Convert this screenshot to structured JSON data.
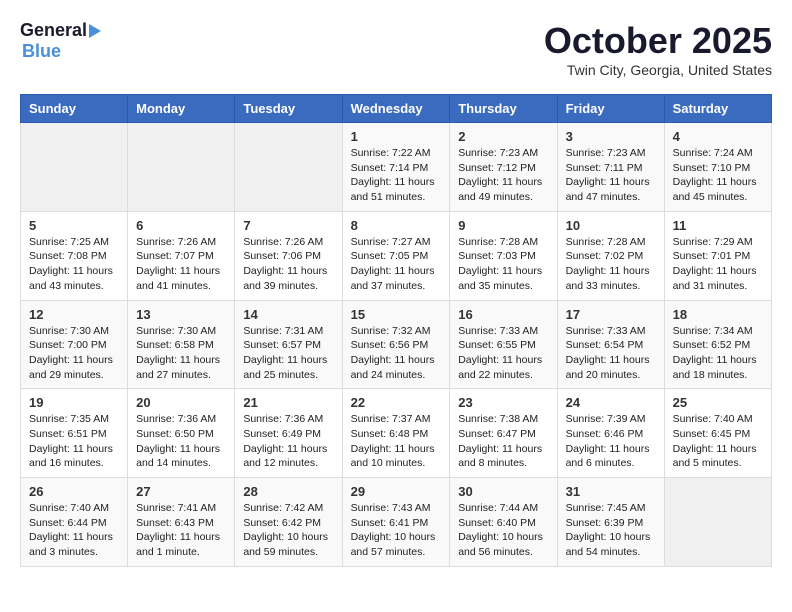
{
  "header": {
    "logo": {
      "line1": "General",
      "line2": "Blue"
    },
    "title": "October 2025",
    "location": "Twin City, Georgia, United States"
  },
  "weekdays": [
    "Sunday",
    "Monday",
    "Tuesday",
    "Wednesday",
    "Thursday",
    "Friday",
    "Saturday"
  ],
  "weeks": [
    [
      {
        "day": "",
        "info": ""
      },
      {
        "day": "",
        "info": ""
      },
      {
        "day": "",
        "info": ""
      },
      {
        "day": "1",
        "info": "Sunrise: 7:22 AM\nSunset: 7:14 PM\nDaylight: 11 hours\nand 51 minutes."
      },
      {
        "day": "2",
        "info": "Sunrise: 7:23 AM\nSunset: 7:12 PM\nDaylight: 11 hours\nand 49 minutes."
      },
      {
        "day": "3",
        "info": "Sunrise: 7:23 AM\nSunset: 7:11 PM\nDaylight: 11 hours\nand 47 minutes."
      },
      {
        "day": "4",
        "info": "Sunrise: 7:24 AM\nSunset: 7:10 PM\nDaylight: 11 hours\nand 45 minutes."
      }
    ],
    [
      {
        "day": "5",
        "info": "Sunrise: 7:25 AM\nSunset: 7:08 PM\nDaylight: 11 hours\nand 43 minutes."
      },
      {
        "day": "6",
        "info": "Sunrise: 7:26 AM\nSunset: 7:07 PM\nDaylight: 11 hours\nand 41 minutes."
      },
      {
        "day": "7",
        "info": "Sunrise: 7:26 AM\nSunset: 7:06 PM\nDaylight: 11 hours\nand 39 minutes."
      },
      {
        "day": "8",
        "info": "Sunrise: 7:27 AM\nSunset: 7:05 PM\nDaylight: 11 hours\nand 37 minutes."
      },
      {
        "day": "9",
        "info": "Sunrise: 7:28 AM\nSunset: 7:03 PM\nDaylight: 11 hours\nand 35 minutes."
      },
      {
        "day": "10",
        "info": "Sunrise: 7:28 AM\nSunset: 7:02 PM\nDaylight: 11 hours\nand 33 minutes."
      },
      {
        "day": "11",
        "info": "Sunrise: 7:29 AM\nSunset: 7:01 PM\nDaylight: 11 hours\nand 31 minutes."
      }
    ],
    [
      {
        "day": "12",
        "info": "Sunrise: 7:30 AM\nSunset: 7:00 PM\nDaylight: 11 hours\nand 29 minutes."
      },
      {
        "day": "13",
        "info": "Sunrise: 7:30 AM\nSunset: 6:58 PM\nDaylight: 11 hours\nand 27 minutes."
      },
      {
        "day": "14",
        "info": "Sunrise: 7:31 AM\nSunset: 6:57 PM\nDaylight: 11 hours\nand 25 minutes."
      },
      {
        "day": "15",
        "info": "Sunrise: 7:32 AM\nSunset: 6:56 PM\nDaylight: 11 hours\nand 24 minutes."
      },
      {
        "day": "16",
        "info": "Sunrise: 7:33 AM\nSunset: 6:55 PM\nDaylight: 11 hours\nand 22 minutes."
      },
      {
        "day": "17",
        "info": "Sunrise: 7:33 AM\nSunset: 6:54 PM\nDaylight: 11 hours\nand 20 minutes."
      },
      {
        "day": "18",
        "info": "Sunrise: 7:34 AM\nSunset: 6:52 PM\nDaylight: 11 hours\nand 18 minutes."
      }
    ],
    [
      {
        "day": "19",
        "info": "Sunrise: 7:35 AM\nSunset: 6:51 PM\nDaylight: 11 hours\nand 16 minutes."
      },
      {
        "day": "20",
        "info": "Sunrise: 7:36 AM\nSunset: 6:50 PM\nDaylight: 11 hours\nand 14 minutes."
      },
      {
        "day": "21",
        "info": "Sunrise: 7:36 AM\nSunset: 6:49 PM\nDaylight: 11 hours\nand 12 minutes."
      },
      {
        "day": "22",
        "info": "Sunrise: 7:37 AM\nSunset: 6:48 PM\nDaylight: 11 hours\nand 10 minutes."
      },
      {
        "day": "23",
        "info": "Sunrise: 7:38 AM\nSunset: 6:47 PM\nDaylight: 11 hours\nand 8 minutes."
      },
      {
        "day": "24",
        "info": "Sunrise: 7:39 AM\nSunset: 6:46 PM\nDaylight: 11 hours\nand 6 minutes."
      },
      {
        "day": "25",
        "info": "Sunrise: 7:40 AM\nSunset: 6:45 PM\nDaylight: 11 hours\nand 5 minutes."
      }
    ],
    [
      {
        "day": "26",
        "info": "Sunrise: 7:40 AM\nSunset: 6:44 PM\nDaylight: 11 hours\nand 3 minutes."
      },
      {
        "day": "27",
        "info": "Sunrise: 7:41 AM\nSunset: 6:43 PM\nDaylight: 11 hours\nand 1 minute."
      },
      {
        "day": "28",
        "info": "Sunrise: 7:42 AM\nSunset: 6:42 PM\nDaylight: 10 hours\nand 59 minutes."
      },
      {
        "day": "29",
        "info": "Sunrise: 7:43 AM\nSunset: 6:41 PM\nDaylight: 10 hours\nand 57 minutes."
      },
      {
        "day": "30",
        "info": "Sunrise: 7:44 AM\nSunset: 6:40 PM\nDaylight: 10 hours\nand 56 minutes."
      },
      {
        "day": "31",
        "info": "Sunrise: 7:45 AM\nSunset: 6:39 PM\nDaylight: 10 hours\nand 54 minutes."
      },
      {
        "day": "",
        "info": ""
      }
    ]
  ]
}
